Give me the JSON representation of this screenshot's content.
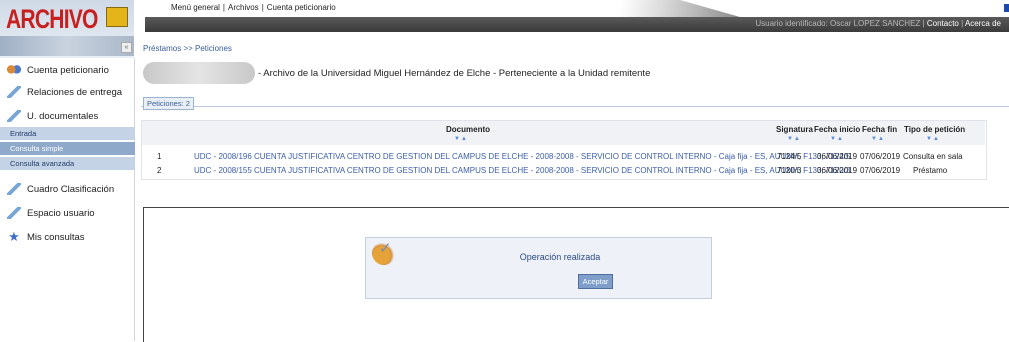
{
  "logo": {
    "text": "ARCHIVO"
  },
  "top_menu": [
    "Menú general",
    "Archivos",
    "Cuenta peticionario"
  ],
  "header": {
    "user_label": "Usuario identificado: Oscar LOPEZ SANCHEZ",
    "contact": "Contacto",
    "about": "Acerca de"
  },
  "sidebar": {
    "collapse_icon": "«",
    "items": [
      {
        "label": "Cuenta peticionario",
        "icon": "people-icon"
      },
      {
        "label": "Relaciones de entrega",
        "icon": "wrench-icon"
      },
      {
        "label": "U. documentales",
        "icon": "wrench-icon"
      },
      {
        "label": "Cuadro Clasificación",
        "icon": "wrench-icon"
      },
      {
        "label": "Espacio usuario",
        "icon": "wrench-icon"
      },
      {
        "label": "Mis consultas",
        "icon": "star-icon"
      }
    ],
    "subitems": [
      "Entrada",
      "Consulta simple",
      "Consulta avanzada"
    ],
    "active_subitem": "Consulta simple"
  },
  "breadcrumb": "Préstamos >> Peticiones",
  "archive_title": "- Archivo de la Universidad Miguel Hernández de Elche - Perteneciente a la Unidad remitente",
  "tab_label": "Peticiones: 2",
  "table": {
    "headers": [
      "Documento",
      "Signatura",
      "Fecha inicio",
      "Fecha fin",
      "Tipo de petición"
    ],
    "sort_glyph": "▼▲",
    "rows": [
      {
        "n": "1",
        "documento": "UDC - 2008/196 CUENTA JUSTIFICATIVA CENTRO DE GESTION DEL CAMPUS DE ELCHE - 2008-2008 - SERVICIO DE CONTROL INTERNO - Caja fija - ES, AUUMH, F133, 7124/5",
        "signatura": "7124/5",
        "fecha_inicio": "06/06/2019",
        "fecha_fin": "07/06/2019",
        "tipo": "Consulta en sala"
      },
      {
        "n": "2",
        "documento": "UDC - 2008/155 CUENTA JUSTIFICATIVA CENTRO DE GESTION DEL CAMPUS DE ELCHE - 2008-2008 - SERVICIO DE CONTROL INTERNO - Caja fija - ES, AUUMH, F133, 7120/3",
        "signatura": "7120/3",
        "fecha_inicio": "06/06/2019",
        "fecha_fin": "07/06/2019",
        "tipo": "Préstamo"
      }
    ]
  },
  "message": {
    "text": "Operación realizada",
    "button": "Aceptar"
  }
}
